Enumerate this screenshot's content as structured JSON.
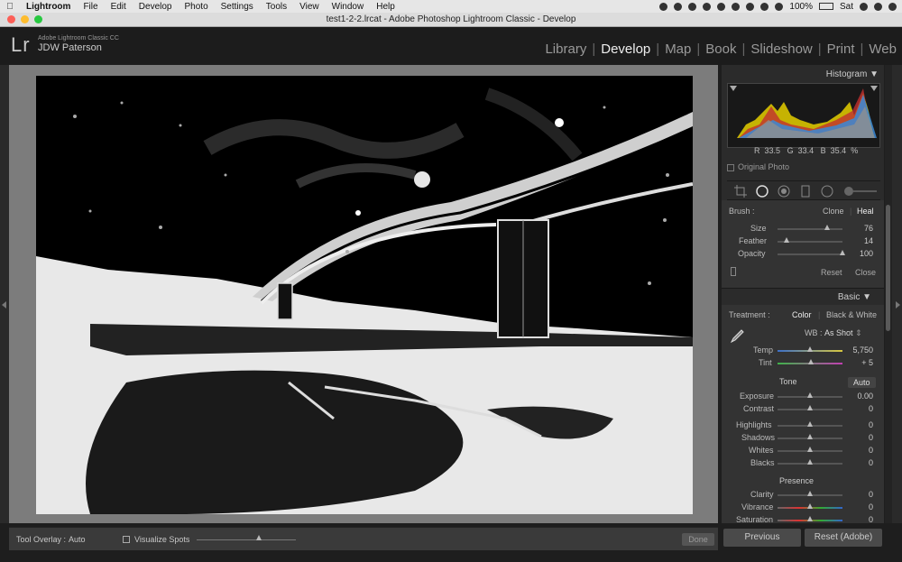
{
  "menubar": {
    "app": "Lightroom",
    "items": [
      "File",
      "Edit",
      "Develop",
      "Photo",
      "Settings",
      "Tools",
      "View",
      "Window",
      "Help"
    ],
    "battery": "100%",
    "day": "Sat"
  },
  "window": {
    "title": "test1-2-2.lrcat - Adobe Photoshop Lightroom Classic - Develop"
  },
  "identity": {
    "logo": "Lr",
    "product": "Adobe Lightroom Classic CC",
    "user": "JDW Paterson"
  },
  "modules": [
    "Library",
    "Develop",
    "Map",
    "Book",
    "Slideshow",
    "Print",
    "Web"
  ],
  "active_module": "Develop",
  "toolbar": {
    "overlay_label": "Tool Overlay :",
    "overlay_value": "Auto",
    "visualize_label": "Visualize Spots",
    "done": "Done"
  },
  "histogram": {
    "title": "Histogram",
    "r_label": "R",
    "r": "33.5",
    "g_label": "G",
    "g": "33.4",
    "b_label": "B",
    "b": "35.4",
    "pct": "%",
    "original_photo": "Original Photo"
  },
  "brush": {
    "label": "Brush :",
    "clone": "Clone",
    "heal": "Heal",
    "size_label": "Size",
    "size": "76",
    "size_pos": 0.76,
    "feather_label": "Feather",
    "feather": "14",
    "feather_pos": 0.14,
    "opacity_label": "Opacity",
    "opacity": "100",
    "opacity_pos": 1.0,
    "reset": "Reset",
    "close": "Close"
  },
  "basic": {
    "title": "Basic",
    "treatment_label": "Treatment :",
    "color": "Color",
    "bw": "Black & White",
    "wb_label": "WB :",
    "wb_value": "As Shot",
    "temp_label": "Temp",
    "temp": "5,750",
    "temp_pos": 0.5,
    "tint_label": "Tint",
    "tint": "+ 5",
    "tint_pos": 0.52,
    "tone_title": "Tone",
    "auto": "Auto",
    "exposure_label": "Exposure",
    "exposure": "0.00",
    "contrast_label": "Contrast",
    "contrast": "0",
    "highlights_label": "Highlights",
    "highlights": "0",
    "shadows_label": "Shadows",
    "shadows": "0",
    "whites_label": "Whites",
    "whites": "0",
    "blacks_label": "Blacks",
    "blacks": "0",
    "presence_title": "Presence",
    "clarity_label": "Clarity",
    "clarity": "0",
    "vibrance_label": "Vibrance",
    "vibrance": "0",
    "saturation_label": "Saturation",
    "saturation": "0"
  },
  "bottom": {
    "previous": "Previous",
    "reset": "Reset (Adobe)"
  },
  "colors": {
    "panel": "#2b2b2b",
    "canvas": "#7c7c7c",
    "active_text": "#eeeeee"
  }
}
